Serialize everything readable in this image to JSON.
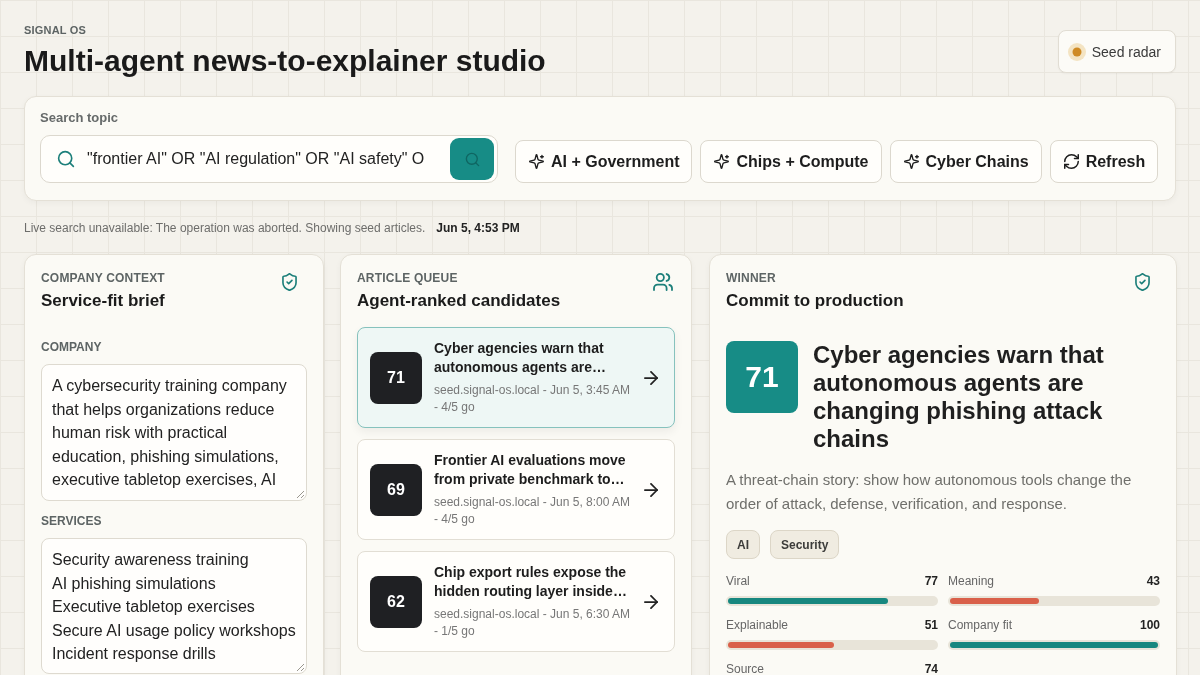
{
  "app": {
    "eyebrow": "SIGNAL OS",
    "title": "Multi-agent news-to-explainer studio",
    "radar_button": "Seed radar"
  },
  "search": {
    "label": "Search topic",
    "value": "\"frontier AI\" OR \"AI regulation\" OR \"AI safety\" O",
    "presets": [
      {
        "label": "AI + Government",
        "kind": "topic"
      },
      {
        "label": "Chips + Compute",
        "kind": "topic"
      },
      {
        "label": "Cyber Chains",
        "kind": "topic"
      },
      {
        "label": "Refresh",
        "kind": "refresh"
      }
    ]
  },
  "status": {
    "message": "Live search unavailable: The operation was aborted. Showing seed articles.",
    "time": "Jun 5, 4:53 PM"
  },
  "company_panel": {
    "eyebrow": "COMPANY CONTEXT",
    "title": "Service-fit brief",
    "company_label": "COMPANY",
    "company_text": "A cybersecurity training company that helps organizations reduce human risk with practical education, phishing simulations, executive tabletop exercises, AI",
    "services_label": "SERVICES",
    "services_text": "Security awareness training\nAI phishing simulations\nExecutive tabletop exercises\nSecure AI usage policy workshops\nIncident response drills"
  },
  "queue": {
    "eyebrow": "ARTICLE QUEUE",
    "title": "Agent-ranked candidates",
    "articles": [
      {
        "score": "71",
        "title": "Cyber agencies warn that autonomous agents are…",
        "meta": "seed.signal-os.local - Jun 5, 3:45 AM - 4/5 go",
        "selected": true
      },
      {
        "score": "69",
        "title": "Frontier AI evaluations move from private benchmark to…",
        "meta": "seed.signal-os.local - Jun 5, 8:00 AM - 4/5 go",
        "selected": false
      },
      {
        "score": "62",
        "title": "Chip export rules expose the hidden routing layer inside…",
        "meta": "seed.signal-os.local - Jun 5, 6:30 AM - 1/5 go",
        "selected": false
      }
    ]
  },
  "winner": {
    "eyebrow": "WINNER",
    "title": "Commit to production",
    "score": "71",
    "headline": "Cyber agencies warn that autonomous agents are changing phishing attack chains",
    "summary": "A threat-chain story: show how autonomous tools change the order of attack, defense, verification, and response.",
    "tags": [
      "AI",
      "Security"
    ],
    "metrics": [
      {
        "label": "Viral",
        "value": "77",
        "level": 0.77,
        "color": "#17877f"
      },
      {
        "label": "Meaning",
        "value": "43",
        "level": 0.43,
        "color": "#d9604a"
      },
      {
        "label": "Explainable",
        "value": "51",
        "level": 0.51,
        "color": "#d9604a"
      },
      {
        "label": "Company fit",
        "value": "100",
        "level": 1,
        "color": "#17877f"
      },
      {
        "label": "Source",
        "value": "74"
      }
    ]
  }
}
